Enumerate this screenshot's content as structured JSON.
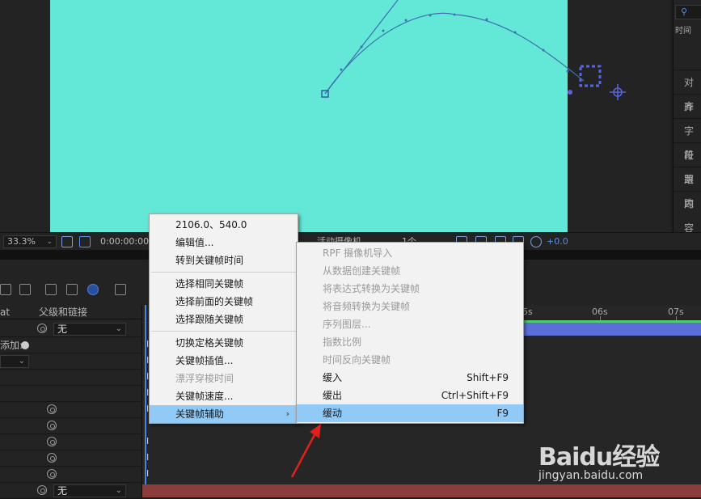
{
  "right_panel": {
    "search_icon": "search-icon",
    "time_label": "时间",
    "items": [
      "对齐",
      "库",
      "字符",
      "段落",
      "跟踪",
      "内容"
    ]
  },
  "viewer_toolbar": {
    "zoom": "33.3%",
    "timecode": "0:00:00:00",
    "camera": "活动摄像机",
    "views": "1个",
    "exposure": "+0.0"
  },
  "timeline": {
    "col_left": "at",
    "col_parent": "父级和链接",
    "add_label": "添加:",
    "parent_none": "无",
    "ruler_labels": [
      "5s",
      "06s",
      "07s"
    ]
  },
  "context_menu": {
    "items": [
      {
        "label": "2106.0、540.0",
        "disabled": false
      },
      {
        "label": "编辑值...",
        "disabled": false
      },
      {
        "label": "转到关键帧时间",
        "disabled": false
      },
      {
        "sep": true
      },
      {
        "label": "选择相同关键帧",
        "disabled": false
      },
      {
        "label": "选择前面的关键帧",
        "disabled": false
      },
      {
        "label": "选择跟随关键帧",
        "disabled": false
      },
      {
        "sep": true
      },
      {
        "label": "切换定格关键帧",
        "disabled": false
      },
      {
        "label": "关键帧插值...",
        "disabled": false
      },
      {
        "label": "漂浮穿梭时间",
        "disabled": true
      },
      {
        "label": "关键帧速度...",
        "disabled": false
      },
      {
        "label": "关键帧辅助",
        "disabled": false,
        "highlighted": true,
        "submenu": true
      }
    ]
  },
  "submenu": {
    "items": [
      {
        "label": "RPF 摄像机导入",
        "shortcut": "",
        "disabled": true
      },
      {
        "label": "从数据创建关键帧",
        "shortcut": "",
        "disabled": true
      },
      {
        "label": "将表达式转换为关键帧",
        "shortcut": "",
        "disabled": true
      },
      {
        "label": "将音频转换为关键帧",
        "shortcut": "",
        "disabled": true
      },
      {
        "label": "序列图层...",
        "shortcut": "",
        "disabled": true
      },
      {
        "label": "指数比例",
        "shortcut": "",
        "disabled": true
      },
      {
        "label": "时间反向关键帧",
        "shortcut": "",
        "disabled": true
      },
      {
        "label": "缓入",
        "shortcut": "Shift+F9",
        "disabled": false
      },
      {
        "label": "缓出",
        "shortcut": "Ctrl+Shift+F9",
        "disabled": false
      },
      {
        "label": "缓动",
        "shortcut": "F9",
        "disabled": false,
        "highlighted": true
      }
    ]
  },
  "watermark": {
    "logo": "Baidu经验",
    "url": "jingyan.baidu.com"
  },
  "colors": {
    "canvas": "#63e8d8",
    "menu_highlight": "#91c9f7",
    "path": "#3e6fb0",
    "arrow": "#e0201c"
  }
}
